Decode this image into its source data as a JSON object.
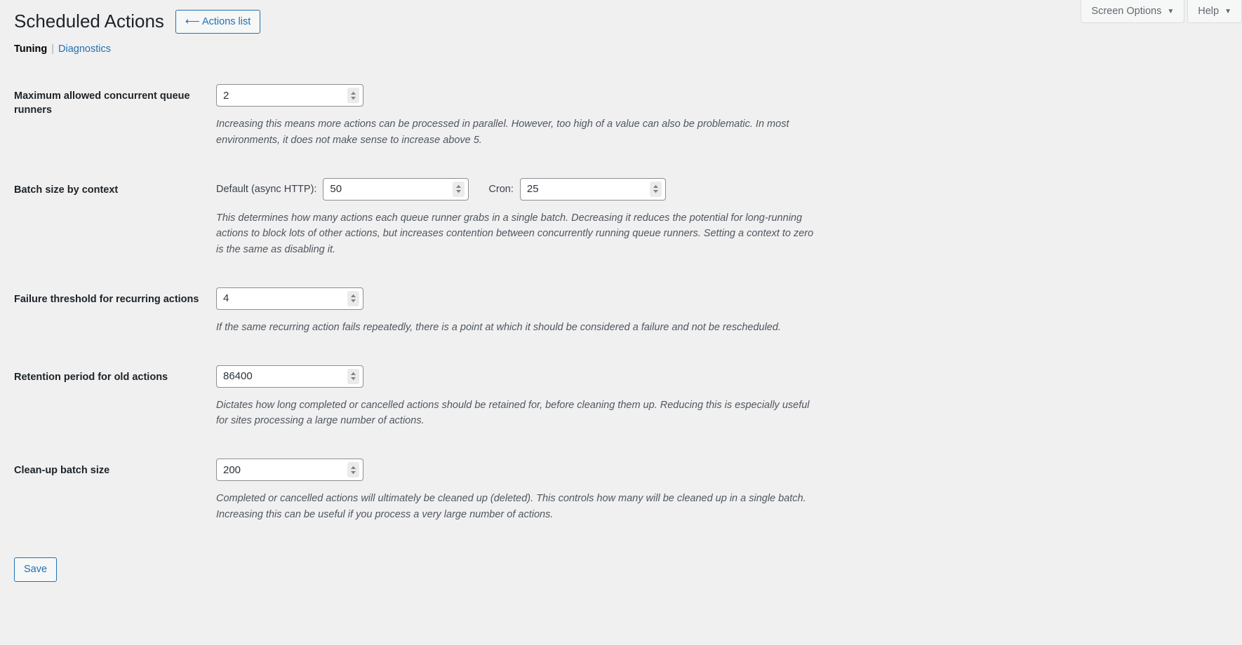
{
  "meta_bar": {
    "screen_options_label": "Screen Options",
    "help_label": "Help",
    "caret_glyph": "▼"
  },
  "header": {
    "page_title": "Scheduled Actions",
    "actions_list_button": "⟵ Actions list",
    "actions_list_arrow": "←",
    "actions_list_text": "Actions list"
  },
  "tabs": {
    "current": "Tuning",
    "separator": "|",
    "link": "Diagnostics"
  },
  "settings": [
    {
      "label": "Maximum allowed concurrent queue runners",
      "value": "2",
      "description": "Increasing this means more actions can be processed in parallel. However, too high of a value can also be problematic. In most environments, it does not make sense to increase above 5."
    },
    {
      "label": "Batch size by context",
      "inputs": [
        {
          "inline_label": "Default (async HTTP):",
          "value": "50"
        },
        {
          "inline_label": "Cron:",
          "value": "25"
        }
      ],
      "description": "This determines how many actions each queue runner grabs in a single batch. Decreasing it reduces the potential for long-running actions to block lots of other actions, but increases contention between concurrently running queue runners. Setting a context to zero is the same as disabling it."
    },
    {
      "label": "Failure threshold for recurring actions",
      "value": "4",
      "description": "If the same recurring action fails repeatedly, there is a point at which it should be considered a failure and not be rescheduled."
    },
    {
      "label": "Retention period for old actions",
      "value": "86400",
      "description": "Dictates how long completed or cancelled actions should be retained for, before cleaning them up. Reducing this is especially useful for sites processing a large number of actions."
    },
    {
      "label": "Clean-up batch size",
      "value": "200",
      "description": "Completed or cancelled actions will ultimately be cleaned up (deleted). This controls how many will be cleaned up in a single batch. Increasing this can be useful if you process a very large number of actions."
    }
  ],
  "submit": {
    "save_label": "Save"
  },
  "colors": {
    "page_background": "#f0f0f1",
    "accent_blue": "#2271b1",
    "heading_text": "#1d2327",
    "body_text": "#3c434a",
    "muted_text": "#50575e",
    "input_border": "#8c8f94"
  }
}
